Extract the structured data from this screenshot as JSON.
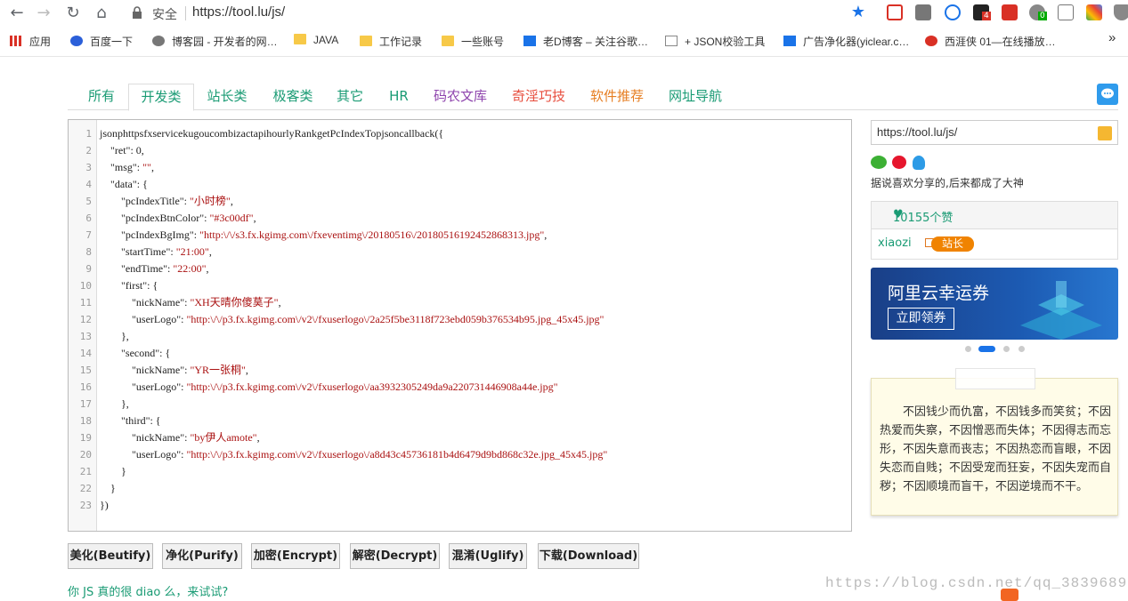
{
  "browser": {
    "secure_label": "安全",
    "url": "https://tool.lu/js/",
    "bookmarks": [
      "应用",
      "百度一下",
      "博客园 - 开发者的网…",
      "JAVA",
      "工作记录",
      "一些账号",
      "老D博客 – 关注谷歌…",
      "+ JSON校验工具",
      "广告净化器(yiclear.c…",
      "西涯侠 01—在线播放…"
    ],
    "ext_badges": [
      "4",
      "0"
    ],
    "more": "»"
  },
  "tabs": [
    {
      "label": "所有",
      "color": "#1a9b74"
    },
    {
      "label": "开发类",
      "color": "#1a9b74"
    },
    {
      "label": "站长类",
      "color": "#1a9b74"
    },
    {
      "label": "极客类",
      "color": "#1a9b74"
    },
    {
      "label": "其它",
      "color": "#1a9b74"
    },
    {
      "label": "HR",
      "color": "#1a9b74"
    },
    {
      "label": "码农文库",
      "color": "#8e44ad"
    },
    {
      "label": "奇淫巧技",
      "color": "#e74c3c"
    },
    {
      "label": "软件推荐",
      "color": "#e67e22"
    },
    {
      "label": "网址导航",
      "color": "#1a9b74"
    }
  ],
  "editor": {
    "lines": [
      [
        {
          "t": "jsonphttpsfxservicekugoucombizactapihourlyRankgetPcIndexTopjsoncallback({",
          "c": "k"
        }
      ],
      [
        {
          "t": "    \"ret\": 0,",
          "c": "k"
        }
      ],
      [
        {
          "t": "    \"msg\": ",
          "c": "k"
        },
        {
          "t": "\"\"",
          "c": "s"
        },
        {
          "t": ",",
          "c": "k"
        }
      ],
      [
        {
          "t": "    \"data\": {",
          "c": "k"
        }
      ],
      [
        {
          "t": "        \"pcIndexTitle\": ",
          "c": "k"
        },
        {
          "t": "\"小时榜\"",
          "c": "s"
        },
        {
          "t": ",",
          "c": "k"
        }
      ],
      [
        {
          "t": "        \"pcIndexBtnColor\": ",
          "c": "k"
        },
        {
          "t": "\"#3c00df\"",
          "c": "s"
        },
        {
          "t": ",",
          "c": "k"
        }
      ],
      [
        {
          "t": "        \"pcIndexBgImg\": ",
          "c": "k"
        },
        {
          "t": "\"http:\\/\\/s3.fx.kgimg.com\\/fxeventimg\\/20180516\\/20180516192452868313.jpg\"",
          "c": "s"
        },
        {
          "t": ",",
          "c": "k"
        }
      ],
      [
        {
          "t": "        \"startTime\": ",
          "c": "k"
        },
        {
          "t": "\"21:00\"",
          "c": "s"
        },
        {
          "t": ",",
          "c": "k"
        }
      ],
      [
        {
          "t": "        \"endTime\": ",
          "c": "k"
        },
        {
          "t": "\"22:00\"",
          "c": "s"
        },
        {
          "t": ",",
          "c": "k"
        }
      ],
      [
        {
          "t": "        \"first\": {",
          "c": "k"
        }
      ],
      [
        {
          "t": "            \"nickName\": ",
          "c": "k"
        },
        {
          "t": "\"XH天晴你傻茣子\"",
          "c": "s"
        },
        {
          "t": ",",
          "c": "k"
        }
      ],
      [
        {
          "t": "            \"userLogo\": ",
          "c": "k"
        },
        {
          "t": "\"http:\\/\\/p3.fx.kgimg.com\\/v2\\/fxuserlogo\\/2a25f5be3118f723ebd059b376534b95.jpg_45x45.jpg\"",
          "c": "s"
        }
      ],
      [
        {
          "t": "        },",
          "c": "k"
        }
      ],
      [
        {
          "t": "        \"second\": {",
          "c": "k"
        }
      ],
      [
        {
          "t": "            \"nickName\": ",
          "c": "k"
        },
        {
          "t": "\"YR一张桐\"",
          "c": "s"
        },
        {
          "t": ",",
          "c": "k"
        }
      ],
      [
        {
          "t": "            \"userLogo\": ",
          "c": "k"
        },
        {
          "t": "\"http:\\/\\/p3.fx.kgimg.com\\/v2\\/fxuserlogo\\/aa3932305249da9a220731446908a44e.jpg\"",
          "c": "s"
        }
      ],
      [
        {
          "t": "        },",
          "c": "k"
        }
      ],
      [
        {
          "t": "        \"third\": {",
          "c": "k"
        }
      ],
      [
        {
          "t": "            \"nickName\": ",
          "c": "k"
        },
        {
          "t": "\"by伊人amote\"",
          "c": "s"
        },
        {
          "t": ",",
          "c": "k"
        }
      ],
      [
        {
          "t": "            \"userLogo\": ",
          "c": "k"
        },
        {
          "t": "\"http:\\/\\/p3.fx.kgimg.com\\/v2\\/fxuserlogo\\/a8d43c45736181b4d6479d9bd868c32e.jpg_45x45.jpg\"",
          "c": "s"
        }
      ],
      [
        {
          "t": "        }",
          "c": "k"
        }
      ],
      [
        {
          "t": "    }",
          "c": "k"
        }
      ],
      [
        {
          "t": "})",
          "c": "k"
        }
      ]
    ]
  },
  "buttons": [
    "美化(Beutify)",
    "净化(Purify)",
    "加密(Encrypt)",
    "解密(Decrypt)",
    "混淆(Uglify)",
    "下载(Download)"
  ],
  "try_text": "你 JS 真的很 diao 么，来试试?",
  "sidebar": {
    "share_url": "https://tool.lu/js/",
    "share_text": "据说喜欢分享的,后来都成了大神",
    "likes": "10155个赞",
    "user": "xiaozi",
    "badge": "站长",
    "ad_title": "阿里云幸运券",
    "ad_button": "立即领券",
    "quote": "不因钱少而仇富，不因钱多而笑贫；不因热爱而失察，不因憎恶而失体；不因得志而忘形，不因失意而丧志；不因热恋而盲眼，不因失恋而自贱；不因受宠而狂妄，不因失宠而自秽；不因顺境而盲干，不因逆境而不干。"
  },
  "watermark": "https://blog.csdn.net/qq_38396897"
}
